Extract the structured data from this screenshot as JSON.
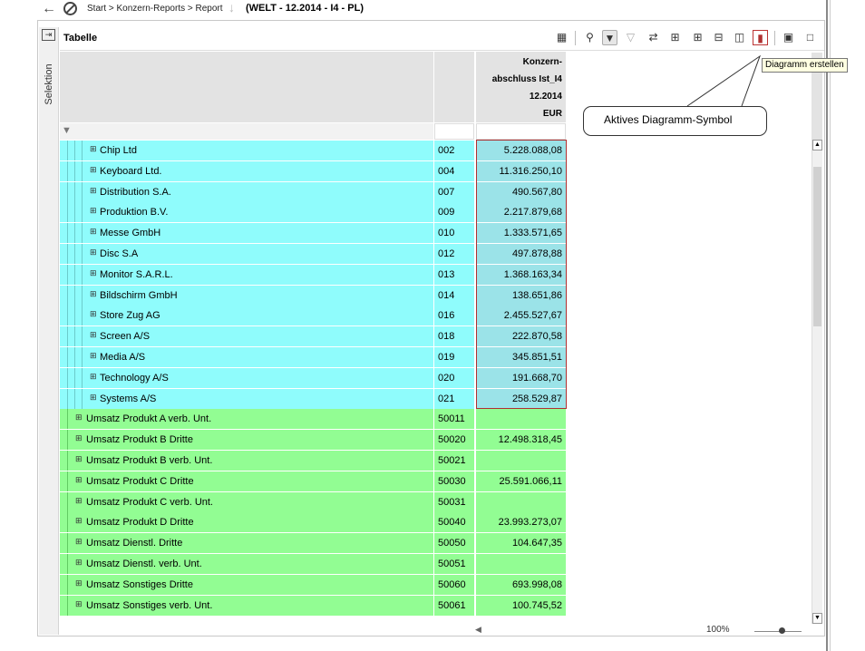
{
  "topbar": {
    "breadcrumb": "Start > Konzern-Reports > Report",
    "context": "(WELT - 12.2014 - I4 - PL)"
  },
  "side": {
    "label": "Selektion"
  },
  "panel": {
    "title": "Tabelle",
    "tooltip": "Diagramm erstellen",
    "callout": "Aktives Diagramm-Symbol"
  },
  "column_header": {
    "line1": "Konzern-",
    "line2": "abschluss Ist_I4",
    "line3": "12.2014",
    "line4": "EUR"
  },
  "rows": [
    {
      "label": "Chip Ltd",
      "code": "002",
      "value": "5.228.088,08"
    },
    {
      "label": "Keyboard Ltd.",
      "code": "004",
      "value": "11.316.250,10"
    },
    {
      "label": "Distribution S.A.",
      "code": "007",
      "value": "490.567,80"
    },
    {
      "label": "Produktion B.V.",
      "code": "009",
      "value": "2.217.879,68"
    },
    {
      "label": "Messe GmbH",
      "code": "010",
      "value": "1.333.571,65"
    },
    {
      "label": "Disc S.A",
      "code": "012",
      "value": "497.878,88"
    },
    {
      "label": "Monitor S.A.R.L.",
      "code": "013",
      "value": "1.368.163,34"
    },
    {
      "label": "Bildschirm GmbH",
      "code": "014",
      "value": "138.651,86"
    },
    {
      "label": "Store Zug AG",
      "code": "016",
      "value": "2.455.527,67"
    },
    {
      "label": "Screen A/S",
      "code": "018",
      "value": "222.870,58"
    },
    {
      "label": "Media A/S",
      "code": "019",
      "value": "345.851,51"
    },
    {
      "label": "Technology A/S",
      "code": "020",
      "value": "191.668,70"
    },
    {
      "label": "Systems A/S",
      "code": "021",
      "value": "258.529,87"
    },
    {
      "label": "Umsatz Produkt A verb. Unt.",
      "code": "50011",
      "value": ""
    },
    {
      "label": "Umsatz Produkt B Dritte",
      "code": "50020",
      "value": "12.498.318,45"
    },
    {
      "label": "Umsatz Produkt B verb. Unt.",
      "code": "50021",
      "value": ""
    },
    {
      "label": "Umsatz Produkt C Dritte",
      "code": "50030",
      "value": "25.591.066,11"
    },
    {
      "label": "Umsatz Produkt C verb. Unt.",
      "code": "50031",
      "value": ""
    },
    {
      "label": "Umsatz Produkt D Dritte",
      "code": "50040",
      "value": "23.993.273,07"
    },
    {
      "label": "Umsatz Dienstl. Dritte",
      "code": "50050",
      "value": "104.647,35"
    },
    {
      "label": "Umsatz Dienstl. verb. Unt.",
      "code": "50051",
      "value": ""
    },
    {
      "label": "Umsatz Sonstiges Dritte",
      "code": "50060",
      "value": "693.998,08"
    },
    {
      "label": "Umsatz Sonstiges verb. Unt.",
      "code": "50061",
      "value": "100.745,52"
    }
  ],
  "zoom": "100%",
  "colors": {
    "company_row": "#8ffcfc",
    "account_row": "#92fd93",
    "active_chart_icon": "#b03030"
  }
}
